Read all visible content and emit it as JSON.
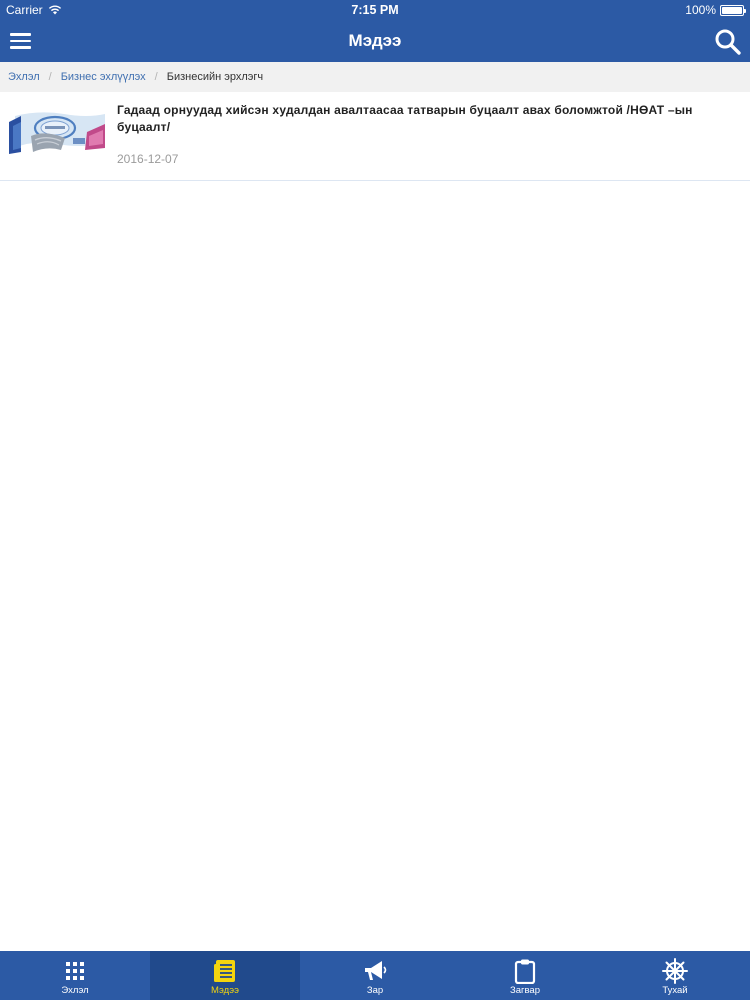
{
  "status_bar": {
    "carrier": "Carrier",
    "time": "7:15 PM",
    "battery": "100%",
    "icons": [
      "wifi-icon",
      "battery-icon"
    ]
  },
  "nav": {
    "title": "Мэдээ",
    "menu_icon": "hamburger-menu-icon",
    "search_icon": "search-icon"
  },
  "breadcrumb": {
    "items": [
      "Эхлэл",
      "Бизнес эхлүүлэх",
      "Бизнесийн эрхлэгч"
    ],
    "separator": "/"
  },
  "news": [
    {
      "title": "Гадаад орнуудад хийсэн худалдан авалтаасаа татварын буцаалт авах боломжтой /НӨАТ –ын буцаалт/",
      "date": "2016-12-07",
      "thumbnail": "tax-refund-thumbnail"
    }
  ],
  "tabs": [
    {
      "label": "Эхлэл",
      "icon": "grid-icon",
      "active": false
    },
    {
      "label": "Мэдээ",
      "icon": "newspaper-icon",
      "active": true
    },
    {
      "label": "Зар",
      "icon": "megaphone-icon",
      "active": false
    },
    {
      "label": "Загвар",
      "icon": "clipboard-icon",
      "active": false
    },
    {
      "label": "Тухай",
      "icon": "ship-wheel-icon",
      "active": false
    }
  ],
  "colors": {
    "primary": "#2c5aa5",
    "active_tab_bg": "#214a8c",
    "active_tab_fg": "#f3d40e",
    "breadcrumb_bg": "#f1f1f1",
    "link": "#3f6fb0",
    "date": "#9b9b9b"
  }
}
